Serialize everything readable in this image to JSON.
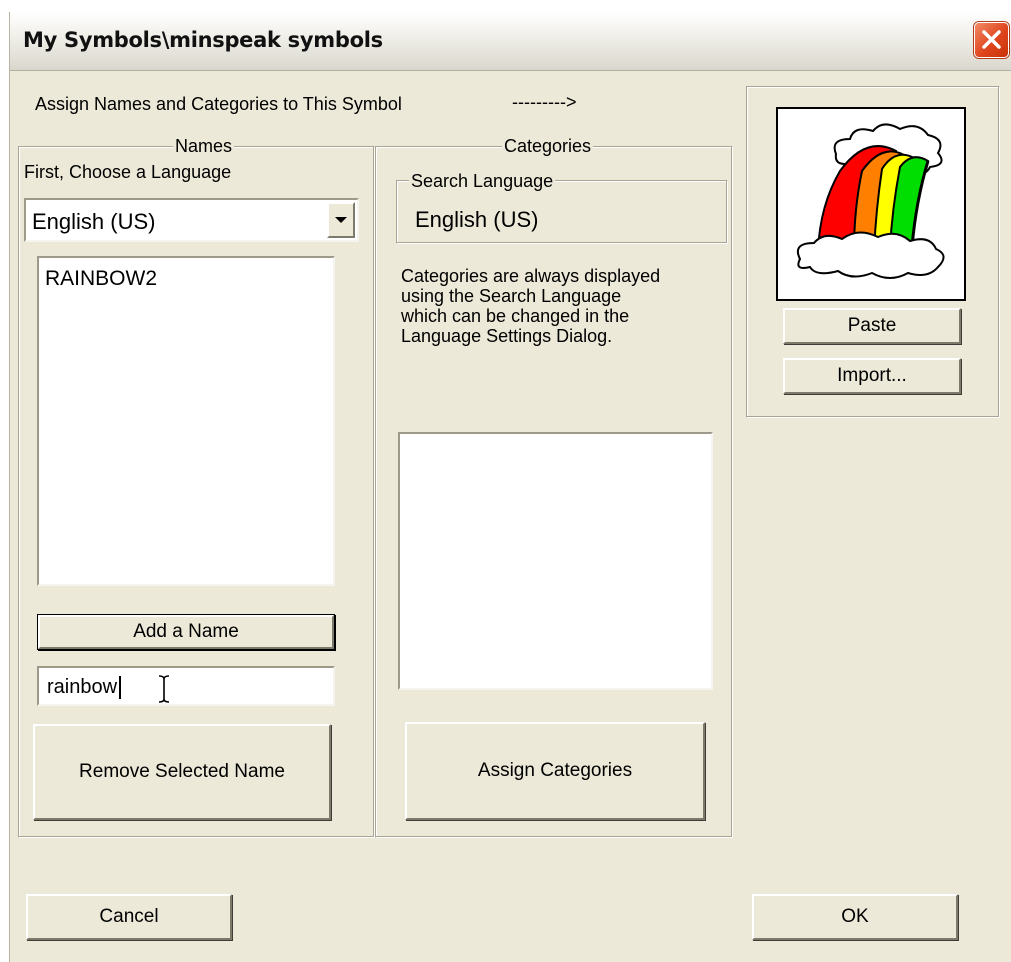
{
  "window": {
    "title": "My Symbols\\minspeak symbols",
    "close_label": "Close"
  },
  "header": {
    "instruction": "Assign Names and Categories to This Symbol",
    "arrow": "--------->"
  },
  "names": {
    "legend": "Names",
    "language_prompt": "First, Choose a Language",
    "language_value": "English (US)",
    "list": [
      "RAINBOW2"
    ],
    "add_label": "Add a Name",
    "input_value": "rainbow",
    "remove_label": "Remove Selected Name"
  },
  "categories": {
    "legend": "Categories",
    "search_language_legend": "Search Language",
    "search_language_value": "English (US)",
    "note_lines": [
      "Categories are always displayed",
      "using the Search Language",
      "which can be changed in the",
      "Language Settings Dialog."
    ],
    "assign_label": "Assign Categories"
  },
  "symbol": {
    "image_icon": "rainbow-cloud-symbol",
    "paste_label": "Paste",
    "import_label": "Import..."
  },
  "footer": {
    "cancel_label": "Cancel",
    "ok_label": "OK"
  },
  "colors": {
    "dialog_bg": "#ece9d8",
    "close_button": "#e0461e",
    "rainbow": [
      "#ff0000",
      "#ff8000",
      "#ffff00",
      "#00dd00"
    ]
  }
}
